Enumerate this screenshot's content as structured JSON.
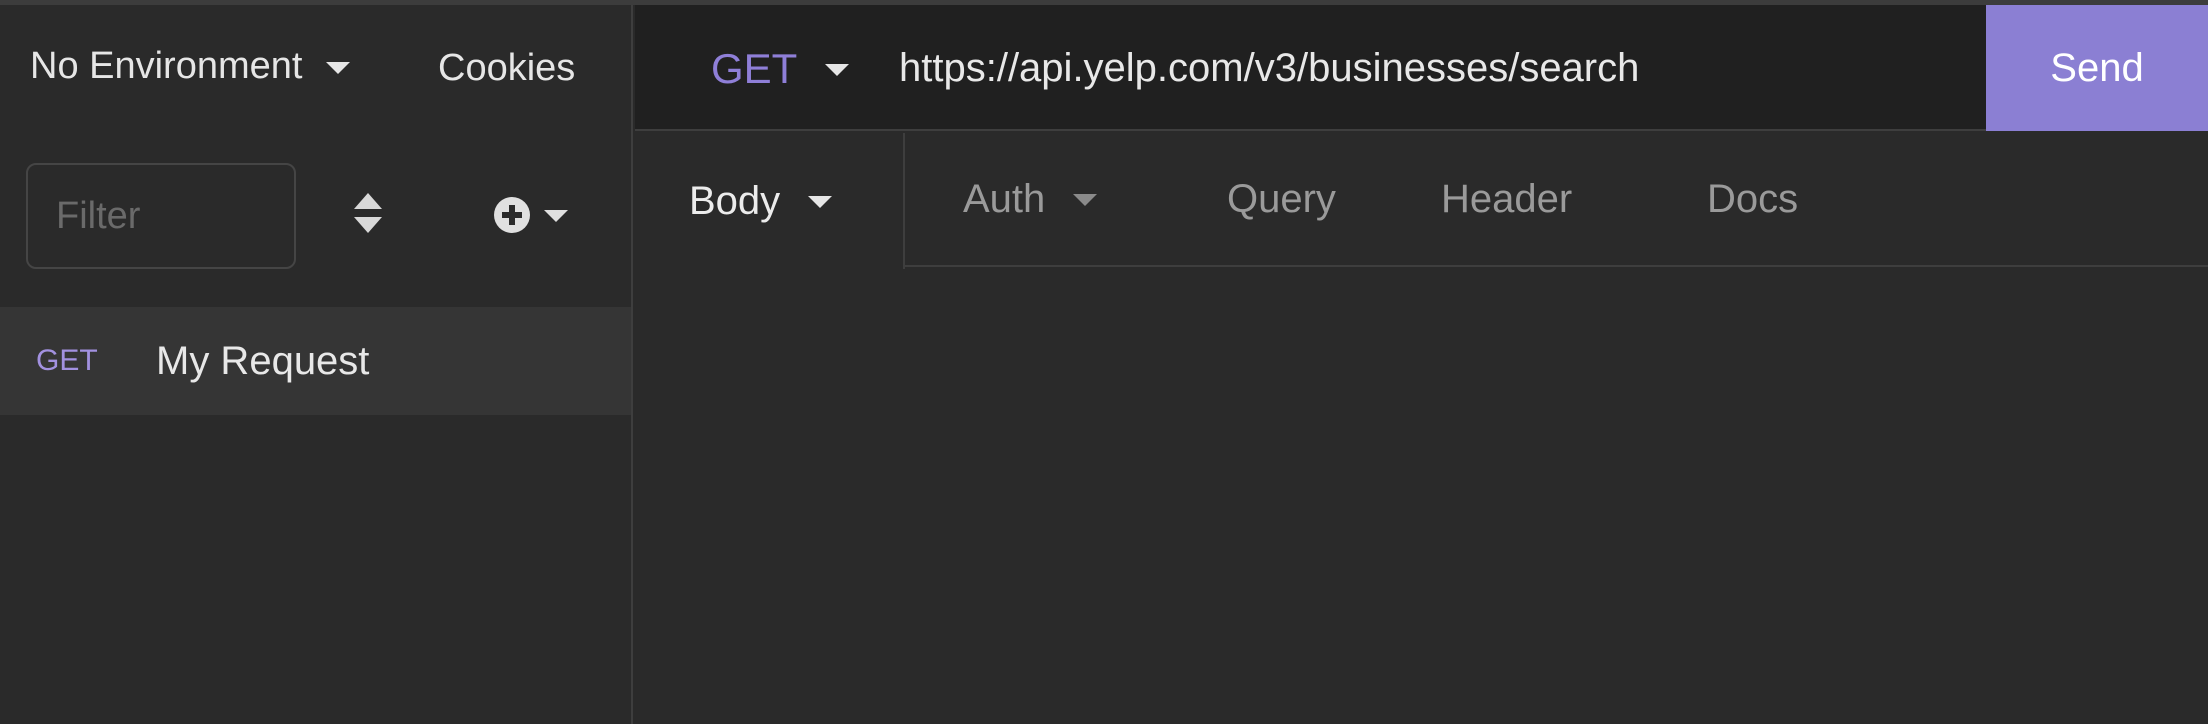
{
  "sidebar": {
    "environment_label": "No Environment",
    "cookies_label": "Cookies",
    "filter_placeholder": "Filter",
    "requests": [
      {
        "method": "GET",
        "name": "My Request"
      }
    ]
  },
  "request": {
    "method": "GET",
    "url": "https://api.yelp.com/v3/businesses/search",
    "send_label": "Send"
  },
  "tabs": {
    "body": "Body",
    "auth": "Auth",
    "query": "Query",
    "header": "Header",
    "docs": "Docs"
  },
  "colors": {
    "accent": "#8b7fd3",
    "method": "#8f7fd8",
    "background": "#2a2a2a",
    "url_bar": "#202020"
  }
}
